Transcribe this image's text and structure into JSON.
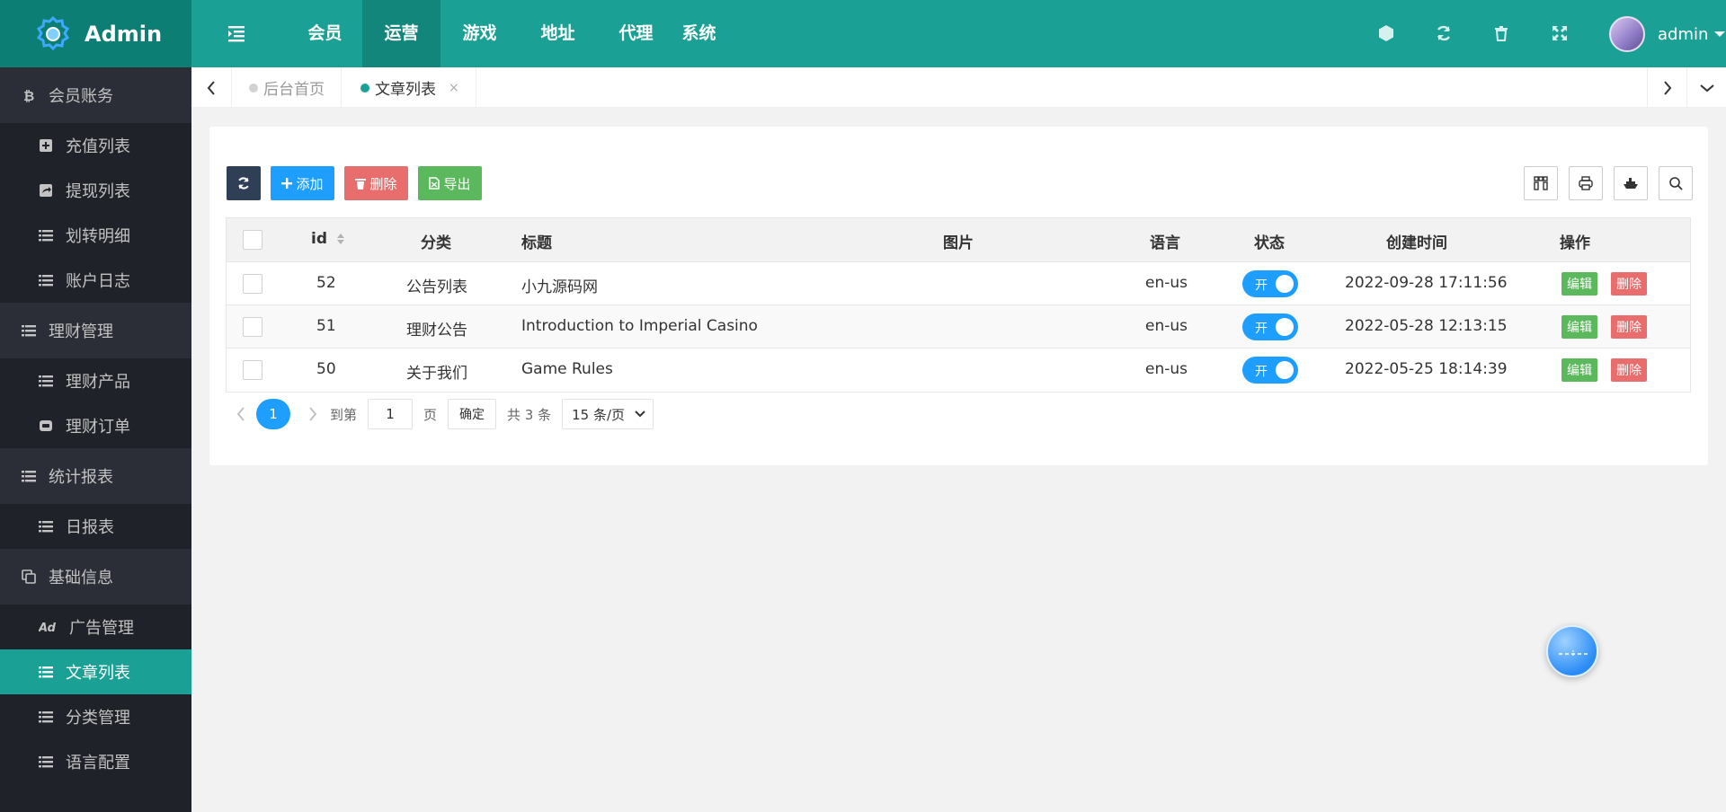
{
  "app": {
    "title": "Admin"
  },
  "top_nav": [
    {
      "label": "会员"
    },
    {
      "label": "运营",
      "active": true
    },
    {
      "label": "游戏"
    },
    {
      "label": "地址"
    },
    {
      "label": "代理"
    },
    {
      "label": "系统"
    }
  ],
  "top_tools": [
    "cube-icon",
    "refresh-icon",
    "trash-icon",
    "fullscreen-icon"
  ],
  "user": {
    "name": "admin"
  },
  "sidebar": {
    "group1": {
      "label": "会员账务",
      "icon": "bitcoin-icon"
    },
    "group1_items": [
      {
        "label": "充值列表",
        "icon": "plus-square-icon"
      },
      {
        "label": "提现列表",
        "icon": "share-square-icon"
      },
      {
        "label": "划转明细",
        "icon": "list-icon"
      },
      {
        "label": "账户日志",
        "icon": "list-icon"
      }
    ],
    "group2": {
      "label": "理财管理",
      "icon": "list-icon"
    },
    "group2_items": [
      {
        "label": "理财产品",
        "icon": "list-icon"
      },
      {
        "label": "理财订单",
        "icon": "ticket-icon"
      }
    ],
    "group3": {
      "label": "统计报表",
      "icon": "list-icon"
    },
    "group3_items": [
      {
        "label": "日报表",
        "icon": "list-icon"
      }
    ],
    "group4": {
      "label": "基础信息",
      "icon": "copy-icon"
    },
    "group4_items": [
      {
        "label": "广告管理",
        "icon": "ad-icon"
      },
      {
        "label": "文章列表",
        "icon": "list-icon",
        "active": true
      },
      {
        "label": "分类管理",
        "icon": "list-icon"
      },
      {
        "label": "语言配置",
        "icon": "list-icon"
      }
    ]
  },
  "tabs": [
    {
      "label": "后台首页"
    },
    {
      "label": "文章列表",
      "active": true,
      "close": "×"
    }
  ],
  "toolbar": {
    "add_label": "添加",
    "delete_label": "删除",
    "export_label": "导出"
  },
  "table": {
    "headers": {
      "id": "id",
      "category": "分类",
      "title": "标题",
      "image": "图片",
      "language": "语言",
      "status": "状态",
      "created": "创建时间",
      "actions": "操作"
    },
    "rows": [
      {
        "id": "52",
        "category": "公告列表",
        "title": "小九源码网",
        "language": "en-us",
        "status": "开",
        "created": "2022-09-28 17:11:56",
        "edit": "编辑",
        "delete": "删除"
      },
      {
        "id": "51",
        "category": "理财公告",
        "title": "Introduction to Imperial Casino",
        "language": "en-us",
        "status": "开",
        "created": "2022-05-28 12:13:15",
        "edit": "编辑",
        "delete": "删除"
      },
      {
        "id": "50",
        "category": "关于我们",
        "title": "Game Rules",
        "language": "en-us",
        "status": "开",
        "created": "2022-05-25 18:14:39",
        "edit": "编辑",
        "delete": "删除"
      }
    ]
  },
  "pagination": {
    "current": "1",
    "goto_label": "到第",
    "goto_value": "1",
    "page_label": "页",
    "confirm_label": "确定",
    "total_label": "共 3 条",
    "per_page": "15 条/页"
  },
  "colors": {
    "topbar": "#1aa094",
    "logo_bg": "#0c7e74",
    "sidebar": "#20222a",
    "primary": "#1e9fff",
    "danger": "#e86e6e",
    "success": "#5cb85c",
    "dark": "#2f4056"
  }
}
